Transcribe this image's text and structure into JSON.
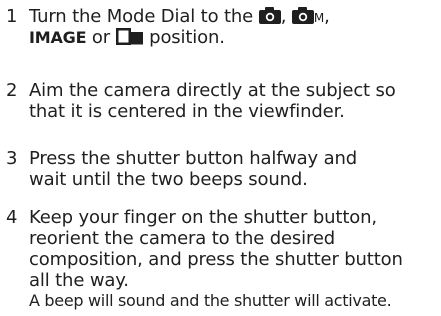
{
  "steps": [
    {
      "number": "1",
      "line1_pre": "Turn the Mode Dial to the ",
      "line1_sep": ", ",
      "icon_sub": "M",
      "line1_post": ",",
      "mode_keyword": "IMAGE",
      "line2_mid": " or ",
      "line2_post": " position.",
      "icons": [
        "camera-icon",
        "camera-manual-icon",
        "stitch-assist-icon"
      ]
    },
    {
      "number": "2",
      "lines": [
        "Aim the camera directly at the subject so",
        "that it is centered in the viewfinder."
      ]
    },
    {
      "number": "3",
      "lines": [
        "Press the shutter button halfway and",
        "wait until the two beeps sound."
      ]
    },
    {
      "number": "4",
      "lines": [
        "Keep your finger on the shutter button,",
        "reorient the camera to the desired",
        "composition, and press the shutter button",
        "all the way."
      ],
      "note": "A beep will sound and the shutter will activate."
    }
  ],
  "colors": {
    "text": "#1f1f1f"
  }
}
